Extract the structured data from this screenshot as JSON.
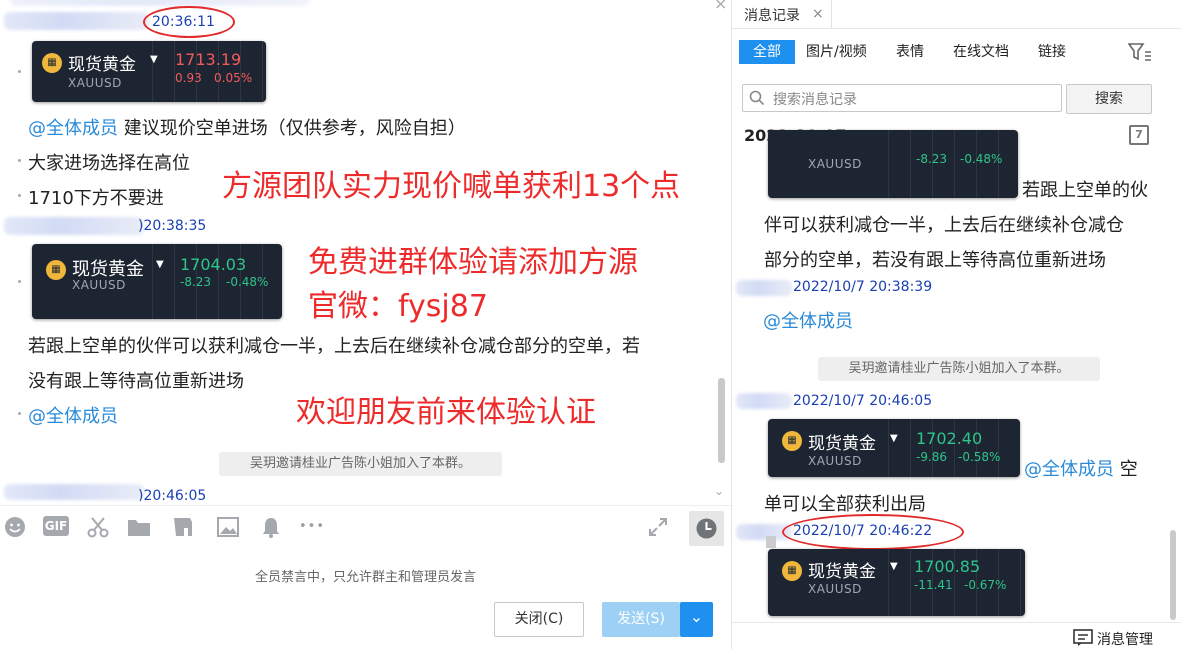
{
  "chat": {
    "close_glyph": "×",
    "time1": "20:36:11",
    "time2": ")20:38:35",
    "time3": ")20:46:05",
    "cards": [
      {
        "name": "现货黄金",
        "symbol": "XAUUSD",
        "price": "1713.19",
        "change": "0.93",
        "pct": "0.05%",
        "color": "#f25a5a"
      },
      {
        "name": "现货黄金",
        "symbol": "XAUUSD",
        "price": "1704.03",
        "change": "-8.23",
        "pct": "-0.48%",
        "color": "#2ec48a"
      }
    ],
    "msg_mention": "@全体成员",
    "msg_suggest": "建议现价空单进场（仅供参考，风险自担）",
    "msg_high": "大家进场选择在高位",
    "msg_below": "1710下方不要进",
    "msg_half_1": "若跟上空单的伙伴可以获利减仓一半，上去后在继续补仓减仓部分的空单，若",
    "msg_half_2": "没有跟上等待高位重新进场",
    "msg_mention2": "@全体成员",
    "system_msg": "吴玥邀请桂业广告陈小姐加入了本群。"
  },
  "promo": {
    "line1": "方源团队实力现价喊单获利13个点",
    "line2": "免费进群体验请添加方源",
    "line3": "官微：fysj87",
    "line4": "欢迎朋友前来体验认证"
  },
  "toolbar": {
    "gif_label": "GIF",
    "more_glyph": "•••",
    "icons": [
      "emoji-icon",
      "gif-icon",
      "scissors-icon",
      "folder-icon",
      "file-transfer-icon",
      "image-icon",
      "bell-icon",
      "more-icon",
      "expand-icon",
      "history-icon"
    ]
  },
  "composer": {
    "muted_notice": "全员禁言中，只允许群主和管理员发言",
    "close_label": "关闭(C)",
    "send_label": "发送(S)",
    "dropdown_glyph": "⌄"
  },
  "history": {
    "tab_title": "消息记录",
    "tab_close": "×",
    "filters": [
      "全部",
      "图片/视频",
      "表情",
      "在线文档",
      "链接"
    ],
    "search_placeholder": "搜索消息记录",
    "search_button": "搜索",
    "date": "2022-10-07",
    "calendar_num": "7",
    "top_card": {
      "symbol": "XAUUSD",
      "change": "-8.23",
      "pct": "-0.48%"
    },
    "msg_half_1": "若跟上空单的伙",
    "msg_half_2": "伴可以获利减仓一半，上去后在继续补仓减仓",
    "msg_half_3": "部分的空单，若没有跟上等待高位重新进场",
    "time1": "2022/10/7 20:38:39",
    "mention1": "@全体成员",
    "system_msg": "吴玥邀请桂业广告陈小姐加入了本群。",
    "time2": "2022/10/7 20:46:05",
    "card2": {
      "name": "现货黄金",
      "symbol": "XAUUSD",
      "price": "1702.40",
      "change": "-9.86",
      "pct": "-0.58%",
      "color": "#2ec48a"
    },
    "mention2": "@全体成员",
    "msg_empty_1": "空",
    "msg_empty_2": "单可以全部获利出局",
    "time3": "2022/10/7 20:46:22",
    "card3": {
      "name": "现货黄金",
      "symbol": "XAUUSD",
      "price": "1700.85",
      "change": "-11.41",
      "pct": "-0.67%",
      "color": "#2ec48a"
    },
    "manage_label": "消息管理"
  }
}
